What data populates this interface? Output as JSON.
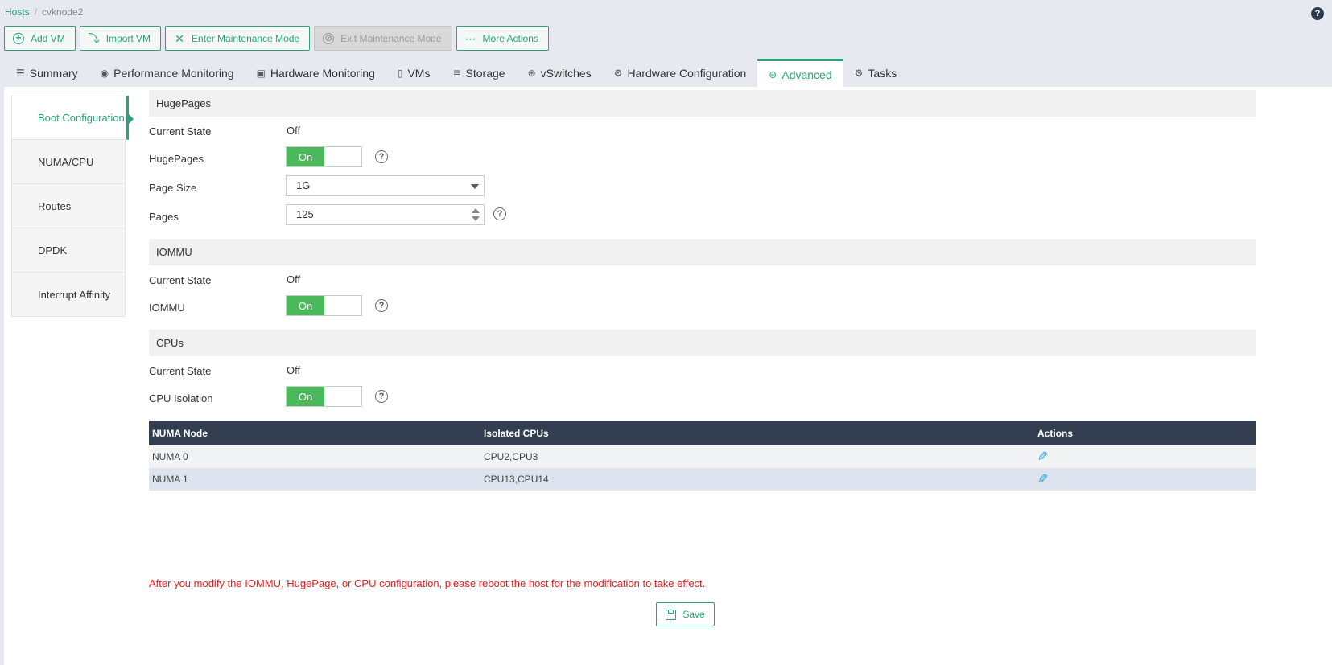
{
  "breadcrumb": {
    "root": "Hosts",
    "separator": "/",
    "current": "cvknode2"
  },
  "help_label": "?",
  "toolbar": {
    "add_vm": "Add VM",
    "import_vm": "Import VM",
    "enter_maintenance": "Enter Maintenance Mode",
    "exit_maintenance": "Exit Maintenance Mode",
    "more_actions": "More Actions"
  },
  "tabs": [
    "Summary",
    "Performance Monitoring",
    "Hardware Monitoring",
    "VMs",
    "Storage",
    "vSwitches",
    "Hardware Configuration",
    "Advanced",
    "Tasks"
  ],
  "active_tab": "Advanced",
  "sidenav": [
    "Boot Configuration",
    "NUMA/CPU",
    "Routes",
    "DPDK",
    "Interrupt Affinity"
  ],
  "active_sidenav": "Boot Configuration",
  "hugepages": {
    "title": "HugePages",
    "current_state_label": "Current State",
    "current_state": "Off",
    "toggle_label": "HugePages",
    "toggle_value": "On",
    "page_size_label": "Page Size",
    "page_size": "1G",
    "pages_label": "Pages",
    "pages": "125"
  },
  "iommu": {
    "title": "IOMMU",
    "current_state_label": "Current State",
    "current_state": "Off",
    "toggle_label": "IOMMU",
    "toggle_value": "On"
  },
  "cpus": {
    "title": "CPUs",
    "current_state_label": "Current State",
    "current_state": "Off",
    "toggle_label": "CPU Isolation",
    "toggle_value": "On"
  },
  "table": {
    "headers": [
      "NUMA Node",
      "Isolated CPUs",
      "Actions"
    ],
    "rows": [
      {
        "node": "NUMA 0",
        "cpus": "CPU2,CPU3"
      },
      {
        "node": "NUMA 1",
        "cpus": "CPU13,CPU14"
      }
    ]
  },
  "warning": "After you modify the IOMMU, HugePage, or CPU configuration, please reboot the host for the modification to take effect.",
  "save_label": "Save",
  "colors": {
    "accent": "#2aa37a",
    "toggle_on": "#4cb85c",
    "table_header": "#323e4f",
    "warning": "#e52020"
  }
}
